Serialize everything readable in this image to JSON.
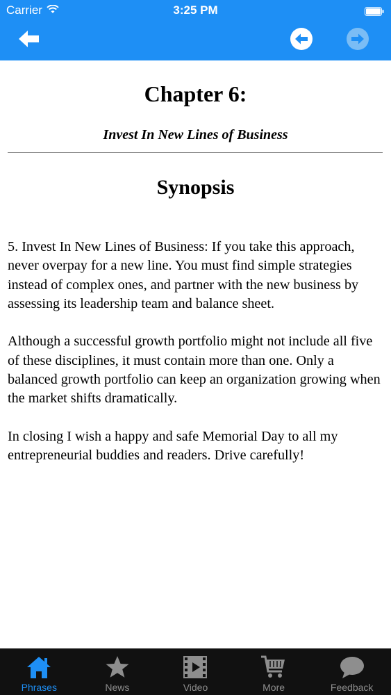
{
  "status_bar": {
    "carrier": "Carrier",
    "time": "3:25 PM"
  },
  "nav": {
    "back_icon": "arrow-left-icon",
    "prev_icon": "circle-arrow-left-icon",
    "next_icon": "circle-arrow-right-icon",
    "next_disabled": true
  },
  "content": {
    "chapter_title": "Chapter 6:",
    "chapter_subtitle": "Invest In New Lines of Business",
    "section_title": "Synopsis",
    "paragraphs": [
      "5. Invest In New Lines of Business: If you take this approach, never overpay for a new line. You must find simple strategies instead of complex ones, and partner with the new business by assessing its leadership team and balance sheet.",
      "Although a successful growth portfolio might not include all five of these disciplines, it must contain more than one. Only a balanced growth portfolio can keep an organization growing when the market shifts dramatically.",
      "In closing I wish a happy and safe Memorial Day to all my entrepreneurial buddies and readers. Drive carefully!"
    ]
  },
  "tabs": [
    {
      "label": "Phrases",
      "icon": "home-icon",
      "active": true
    },
    {
      "label": "News",
      "icon": "star-icon",
      "active": false
    },
    {
      "label": "Video",
      "icon": "film-icon",
      "active": false
    },
    {
      "label": "More",
      "icon": "cart-icon",
      "active": false
    },
    {
      "label": "Feedback",
      "icon": "speech-bubble-icon",
      "active": false
    }
  ],
  "colors": {
    "accent": "#1e8ff5",
    "tab_bar_bg": "#111111",
    "tab_inactive": "#8e8e8e",
    "nav_disabled": "#7bbdf5"
  }
}
